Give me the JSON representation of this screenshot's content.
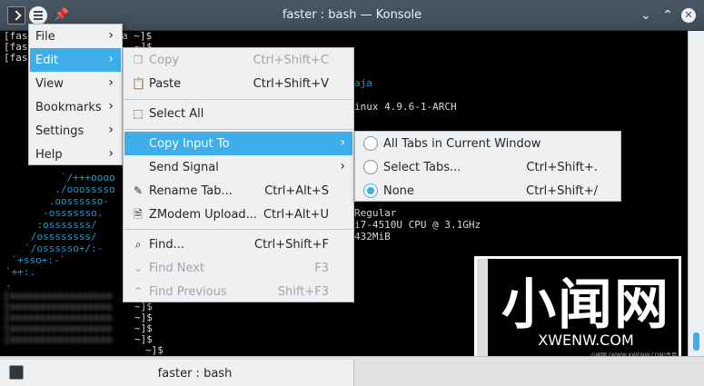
{
  "window": {
    "title": "faster : bash — Konsole",
    "tab_label": "faster : bash"
  },
  "terminal": {
    "prompt_lines": [
      "[fas",
      "[fas",
      "[fas"
    ],
    "prompt_tail_1": "a ~]$",
    "prompt_tail_2": "~]$",
    "info_user": "aja",
    "info_kernel": "inux 4.9.6-1-ARCH",
    "info_font": "Regular",
    "info_cpu": "i7-4510U CPU @ 3.1GHz",
    "info_mem": "432MiB",
    "ascii_art": [
      "        `/+++oooo",
      "       ./ooosssso",
      "      .oossssso-",
      "     -osssssso.",
      "    :osssssss/",
      "   /ossssssss/",
      "  `/ossssso+/:-",
      " `+sso+:-`",
      "`++:.",
      "."
    ],
    "bottom_prompts": [
      "~]$",
      "~]$",
      "~]$",
      "~]$",
      "~]$"
    ]
  },
  "main_menu": {
    "items": [
      {
        "label": "File"
      },
      {
        "label": "Edit"
      },
      {
        "label": "View"
      },
      {
        "label": "Bookmarks"
      },
      {
        "label": "Settings"
      },
      {
        "label": "Help"
      }
    ]
  },
  "edit_menu": {
    "copy": {
      "label": "Copy",
      "shortcut": "Ctrl+Shift+C"
    },
    "paste": {
      "label": "Paste",
      "shortcut": "Ctrl+Shift+V"
    },
    "select_all": {
      "label": "Select All"
    },
    "copy_input_to": {
      "label": "Copy Input To"
    },
    "send_signal": {
      "label": "Send Signal"
    },
    "rename_tab": {
      "label": "Rename Tab...",
      "shortcut": "Ctrl+Alt+S"
    },
    "zmodem": {
      "label": "ZModem Upload...",
      "shortcut": "Ctrl+Alt+U"
    },
    "find": {
      "label": "Find...",
      "shortcut": "Ctrl+Shift+F"
    },
    "find_next": {
      "label": "Find Next",
      "shortcut": "F3"
    },
    "find_previous": {
      "label": "Find Previous",
      "shortcut": "Shift+F3"
    }
  },
  "copy_input_menu": {
    "all_tabs": {
      "label": "All Tabs in Current Window"
    },
    "select_tabs": {
      "label": "Select Tabs...",
      "shortcut": "Ctrl+Shift+."
    },
    "none": {
      "label": "None",
      "shortcut": "Ctrl+Shift+/"
    }
  },
  "watermark": {
    "big": "小闻网",
    "url": "XWENW.COM",
    "small": "小闻网 (WWW.XWENW.COM)专用"
  },
  "colors": {
    "highlight": "#3daee9",
    "menu_bg": "#eff0f1",
    "titlebar": "#3d4a57"
  }
}
